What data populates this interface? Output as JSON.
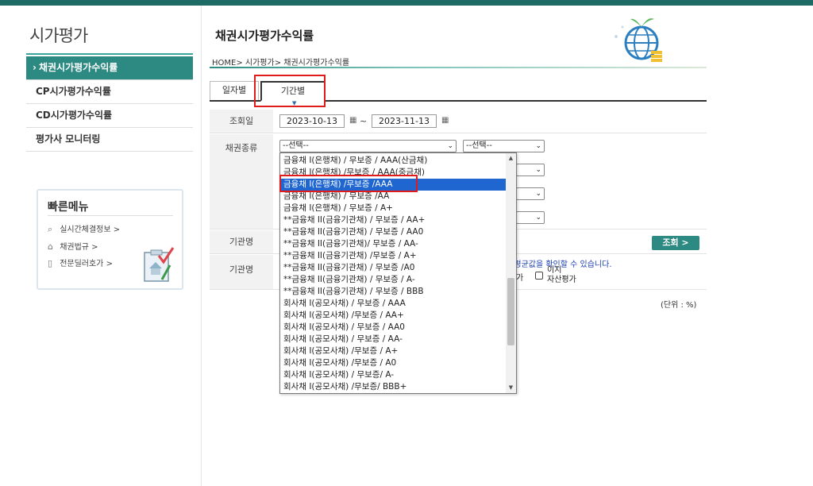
{
  "sidebar": {
    "title": "시가평가",
    "items": [
      {
        "label": "채권시가평가수익률"
      },
      {
        "label": "CP시가평가수익률"
      },
      {
        "label": "CD시가평가수익률"
      },
      {
        "label": "평가사 모니터링"
      }
    ]
  },
  "quick_menu": {
    "title": "빠른메뉴",
    "items": [
      {
        "label": "실시간체결정보 >",
        "icon": "search-icon"
      },
      {
        "label": "채권법규 >",
        "icon": "building-icon"
      },
      {
        "label": "전문딜러호가 >",
        "icon": "document-icon"
      }
    ]
  },
  "header": {
    "title": "채권시가평가수익률",
    "breadcrumb": "HOME> 시가평가> 채권시가평가수익률"
  },
  "tabs": [
    {
      "label": "일자별"
    },
    {
      "label": "기간별"
    }
  ],
  "form": {
    "date_label": "조회일",
    "date_from": "2023-10-13",
    "date_sep": "~",
    "date_to": "2023-11-13",
    "bond_type_label": "채권종류",
    "bond_type_select1": "--선택--",
    "bond_type_select2": "--선택--",
    "org_label1": "기관명",
    "org_label2": "기관명",
    "search_button": "조회 >",
    "notice": "균 평균값을 확인할 수 있습니다.",
    "check_partial": "가",
    "check_label_line1": "이지",
    "check_label_line2": "자산평가",
    "unit": "(단위 : %)"
  },
  "dropdown": {
    "selected_index": 2,
    "options": [
      "금융채 I(은행채) / 무보증 / AAA(산금채)",
      "금융채 I(은행채) /무보증 / AAA(중금채)",
      "금융채 I(은행채) /무보증 /AAA",
      "금융채 I(은행채) / 무보증 /AA",
      "금융채 I(은행채) / 무보증 / A+",
      "**금융채 II(금융기관채) / 무보증 / AA+",
      "**금융채 II(금융기관채) / 무보증 / AA0",
      "**금융채 II(금융기관채)/ 무보증 / AA-",
      "**금융채 II(금융기관채) /무보증 / A+",
      "**금융채 II(금융기관채) / 무보증 /A0",
      "**금융채 II(금융기관채) / 무보증 / A-",
      "**금융채 II(금융기관채) / 무보증 / BBB",
      "회사채 I(공모사채) / 무보증 / AAA",
      "회사채 I(공모사채) /무보증 / AA+",
      "회사채 I(공모사채) / 무보증 / AA0",
      "회사채 I(공모사채) / 무보증 / AA-",
      "회사채 I(공모사채) /무보증 / A+",
      "회사채 I(공모사채) /무보증 / A0",
      "회사채 I(공모사채) / 무보증/ A-",
      "회사채 I(공모사채) /무보증/ BBB+"
    ]
  },
  "colors": {
    "brand": "#2d8a82",
    "highlight": "#e01b1b",
    "selected": "#1f66d1"
  }
}
